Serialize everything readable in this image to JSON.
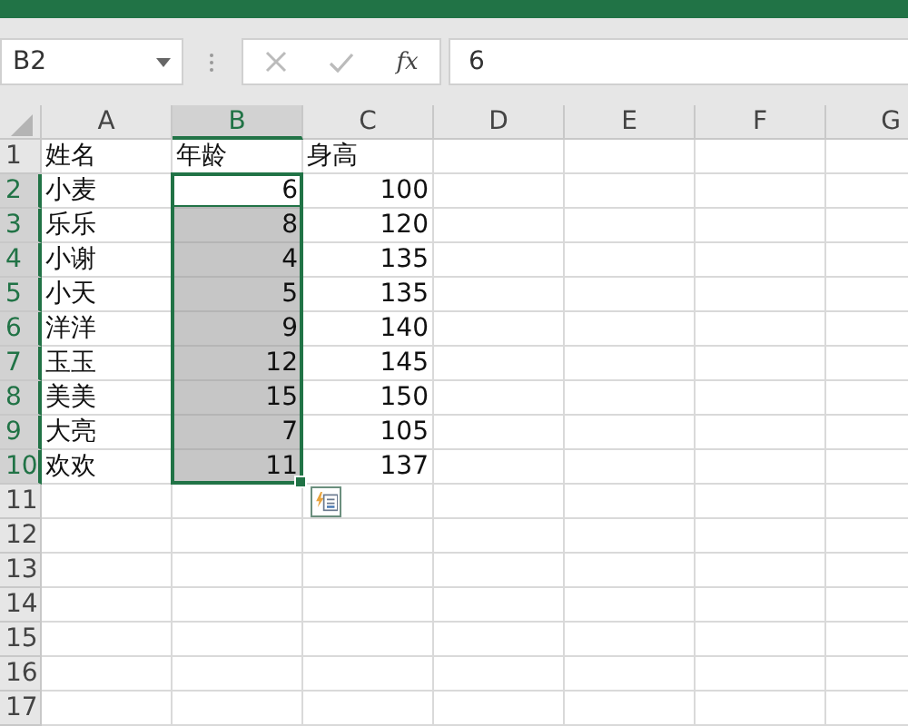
{
  "name_box": {
    "value": "B2"
  },
  "formula_bar": {
    "function_label": "fx",
    "value": "6"
  },
  "columns": [
    {
      "label": "A",
      "selected": false
    },
    {
      "label": "B",
      "selected": true
    },
    {
      "label": "C",
      "selected": false
    },
    {
      "label": "D",
      "selected": false
    },
    {
      "label": "E",
      "selected": false
    },
    {
      "label": "F",
      "selected": false
    },
    {
      "label": "G",
      "selected": false
    }
  ],
  "rows": [
    {
      "label": "1",
      "selected": false,
      "cells": [
        {
          "value": "姓名",
          "kind": "text",
          "selected": false,
          "active": false
        },
        {
          "value": "年龄",
          "kind": "text",
          "selected": false,
          "active": false
        },
        {
          "value": "身高",
          "kind": "text",
          "selected": false,
          "active": false
        }
      ]
    },
    {
      "label": "2",
      "selected": true,
      "cells": [
        {
          "value": "小麦",
          "kind": "text",
          "selected": false,
          "active": false
        },
        {
          "value": "6",
          "kind": "number",
          "selected": true,
          "active": true
        },
        {
          "value": "100",
          "kind": "number",
          "selected": false,
          "active": false
        }
      ]
    },
    {
      "label": "3",
      "selected": true,
      "cells": [
        {
          "value": "乐乐",
          "kind": "text",
          "selected": false,
          "active": false
        },
        {
          "value": "8",
          "kind": "number",
          "selected": true,
          "active": false
        },
        {
          "value": "120",
          "kind": "number",
          "selected": false,
          "active": false
        }
      ]
    },
    {
      "label": "4",
      "selected": true,
      "cells": [
        {
          "value": "小谢",
          "kind": "text",
          "selected": false,
          "active": false
        },
        {
          "value": "4",
          "kind": "number",
          "selected": true,
          "active": false
        },
        {
          "value": "135",
          "kind": "number",
          "selected": false,
          "active": false
        }
      ]
    },
    {
      "label": "5",
      "selected": true,
      "cells": [
        {
          "value": "小天",
          "kind": "text",
          "selected": false,
          "active": false
        },
        {
          "value": "5",
          "kind": "number",
          "selected": true,
          "active": false
        },
        {
          "value": "135",
          "kind": "number",
          "selected": false,
          "active": false
        }
      ]
    },
    {
      "label": "6",
      "selected": true,
      "cells": [
        {
          "value": "洋洋",
          "kind": "text",
          "selected": false,
          "active": false
        },
        {
          "value": "9",
          "kind": "number",
          "selected": true,
          "active": false
        },
        {
          "value": "140",
          "kind": "number",
          "selected": false,
          "active": false
        }
      ]
    },
    {
      "label": "7",
      "selected": true,
      "cells": [
        {
          "value": "玉玉",
          "kind": "text",
          "selected": false,
          "active": false
        },
        {
          "value": "12",
          "kind": "number",
          "selected": true,
          "active": false
        },
        {
          "value": "145",
          "kind": "number",
          "selected": false,
          "active": false
        }
      ]
    },
    {
      "label": "8",
      "selected": true,
      "cells": [
        {
          "value": "美美",
          "kind": "text",
          "selected": false,
          "active": false
        },
        {
          "value": "15",
          "kind": "number",
          "selected": true,
          "active": false
        },
        {
          "value": "150",
          "kind": "number",
          "selected": false,
          "active": false
        }
      ]
    },
    {
      "label": "9",
      "selected": true,
      "cells": [
        {
          "value": "大亮",
          "kind": "text",
          "selected": false,
          "active": false
        },
        {
          "value": "7",
          "kind": "number",
          "selected": true,
          "active": false
        },
        {
          "value": "105",
          "kind": "number",
          "selected": false,
          "active": false
        }
      ]
    },
    {
      "label": "10",
      "selected": true,
      "cells": [
        {
          "value": "欢欢",
          "kind": "text",
          "selected": false,
          "active": false
        },
        {
          "value": "11",
          "kind": "number",
          "selected": true,
          "active": false
        },
        {
          "value": "137",
          "kind": "number",
          "selected": false,
          "active": false
        }
      ]
    },
    {
      "label": "11",
      "selected": false
    },
    {
      "label": "12",
      "selected": false
    },
    {
      "label": "13",
      "selected": false
    },
    {
      "label": "14",
      "selected": false
    },
    {
      "label": "15",
      "selected": false
    },
    {
      "label": "16",
      "selected": false
    },
    {
      "label": "17",
      "selected": false
    }
  ]
}
